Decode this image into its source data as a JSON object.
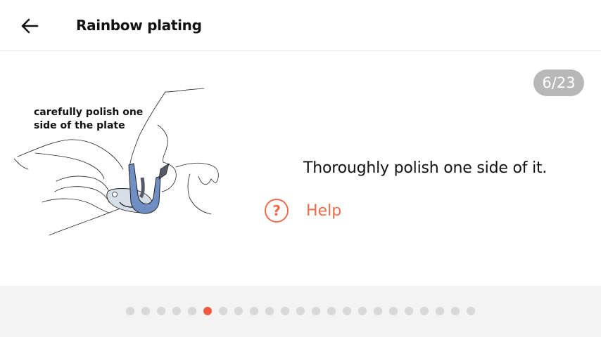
{
  "header": {
    "back_icon": "arrow-left-icon",
    "title": "Rainbow plating"
  },
  "step": {
    "badge": "6/23",
    "current": 6,
    "total": 23
  },
  "illustration": {
    "caption": "carefully polish one side of the plate"
  },
  "instruction": "Thoroughly polish one side of it.",
  "help": {
    "icon": "question-circle-icon",
    "label": "Help"
  },
  "colors": {
    "accent": "#ee6a4e",
    "dot_active": "#ef5a3e",
    "dot_inactive": "#d8d8d8",
    "badge_bg": "#b8b8b8",
    "footer_bg": "#f3f3f3",
    "plate": "#6f8fc4",
    "plate_dark": "#555a66"
  }
}
